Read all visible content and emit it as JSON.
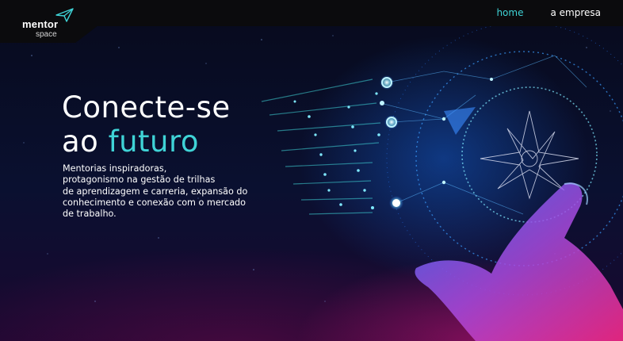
{
  "brand": {
    "word": "mentor",
    "sub": "space",
    "icon": "paper-plane-icon"
  },
  "nav": {
    "items": [
      {
        "label": "home",
        "active": true
      },
      {
        "label": "a empresa",
        "active": false
      }
    ]
  },
  "hero": {
    "headline_line1": "Conecte-se",
    "headline_line2_prefix": "ao ",
    "headline_line2_accent": "futuro",
    "description_lines": [
      "Mentorias inspiradoras,",
      "protagonismo na gestão de trilhas",
      "de aprendizagem e carreria, expansão do",
      "conhecimento e conexão com o mercado",
      "de trabalho."
    ],
    "image": "glowing-hand-network-icon"
  },
  "colors": {
    "accent": "#3fd3d6",
    "topbar": "#0b0b0d",
    "background": "#070a1c",
    "magenta": "#c8147a",
    "glow_blue": "#2a7cff"
  }
}
